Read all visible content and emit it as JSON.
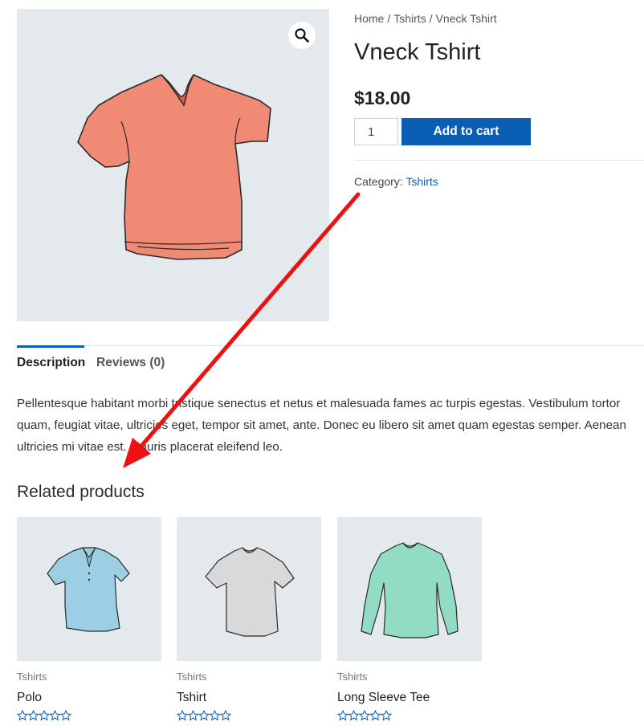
{
  "breadcrumb": {
    "items": [
      "Home",
      "Tshirts",
      "Vneck Tshirt"
    ],
    "separator": "/"
  },
  "product": {
    "title": "Vneck Tshirt",
    "price": "$18.00",
    "quantity": "1",
    "add_to_cart_label": "Add to cart",
    "category_label": "Category:",
    "category_value": "Tshirts",
    "main_image_icon": "vneck-tshirt-image",
    "zoom_icon": "magnifier-icon"
  },
  "tabs": [
    {
      "label": "Description",
      "active": true
    },
    {
      "label": "Reviews (0)",
      "active": false
    }
  ],
  "description": "Pellentesque habitant morbi tristique senectus et netus et malesuada fames ac turpis egestas. Vestibulum tortor quam, feugiat vitae, ultricies eget, tempor sit amet, ante. Donec eu libero sit amet quam egestas semper. Aenean ultricies mi vitae est. Mauris placerat eleifend leo.",
  "related": {
    "title": "Related products",
    "products": [
      {
        "category": "Tshirts",
        "name": "Polo",
        "rating": 0,
        "icon": "polo-shirt-image"
      },
      {
        "category": "Tshirts",
        "name": "Tshirt",
        "rating": 0,
        "icon": "tshirt-image"
      },
      {
        "category": "Tshirts",
        "name": "Long Sleeve Tee",
        "rating": 0,
        "icon": "long-sleeve-tee-image"
      }
    ]
  },
  "annotation": {
    "icon": "red-arrow-annotation"
  },
  "colors": {
    "accent": "#0a5fb4",
    "image_background": "#e4e9ee",
    "annotation_red": "#ee1111",
    "vneck_shirt": "#f08a74",
    "polo_shirt": "#9ccfe4",
    "tshirt": "#d9d9d9",
    "long_sleeve": "#93dcc4"
  }
}
